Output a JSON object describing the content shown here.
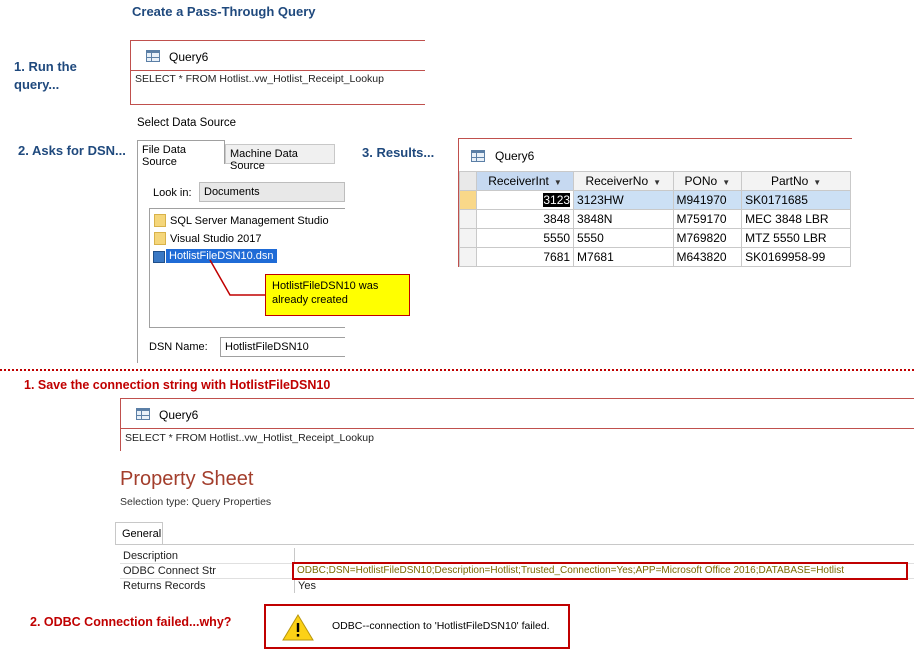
{
  "heading": "Create a Pass-Through Query",
  "steps": {
    "run_query": "1. Run the query...",
    "asks_dsn": "2. Asks for DSN...",
    "results": "3. Results...",
    "save_conn": "1. Save the connection string with HotlistFileDSN10",
    "odbc_failed": "2. ODBC Connection failed...why?"
  },
  "query_window_1": {
    "title": "Query6",
    "sql": "SELECT * FROM Hotlist..vw_Hotlist_Receipt_Lookup"
  },
  "dsn_dialog": {
    "title": "Select Data Source",
    "tabs": [
      "File Data Source",
      "Machine Data Source"
    ],
    "look_in_label": "Look in:",
    "look_in_value": "Documents",
    "items": [
      {
        "label": "SQL Server Management Studio",
        "icon": "folder-icon"
      },
      {
        "label": "Visual Studio 2017",
        "icon": "folder-icon"
      },
      {
        "label": "HotlistFileDSN10.dsn",
        "icon": "dsn-file-icon"
      }
    ],
    "dsn_name_label": "DSN Name:",
    "dsn_name_value": "HotlistFileDSN10",
    "callout": "HotlistFileDSN10 was already created"
  },
  "results_window": {
    "title": "Query6",
    "columns": [
      "ReceiverInt",
      "ReceiverNo",
      "PONo",
      "PartNo"
    ],
    "rows": [
      [
        "3123",
        "3123HW",
        "M941970",
        "SK0171685"
      ],
      [
        "3848",
        "3848N",
        "M759170",
        "MEC 3848 LBR"
      ],
      [
        "5550",
        "5550",
        "M769820",
        "MTZ 5550 LBR"
      ],
      [
        "7681",
        "M7681",
        "M643820",
        "SK0169958-99"
      ]
    ]
  },
  "query_window_2": {
    "title": "Query6",
    "sql": "SELECT * FROM Hotlist..vw_Hotlist_Receipt_Lookup"
  },
  "property_sheet": {
    "title": "Property Sheet",
    "selection_type": "Selection type:  Query Properties",
    "tab": "General",
    "rows": [
      {
        "label": "Description",
        "value": ""
      },
      {
        "label": "ODBC Connect Str",
        "value": "ODBC;DSN=HotlistFileDSN10;Description=Hotlist;Trusted_Connection=Yes;APP=Microsoft Office 2016;DATABASE=Hotlist"
      },
      {
        "label": "Returns Records",
        "value": "Yes"
      }
    ]
  },
  "error_dialog": {
    "message": "ODBC--connection to 'HotlistFileDSN10' failed.",
    "icon": "warning-icon"
  },
  "colors": {
    "accent_blue": "#1f497d",
    "accent_red": "#c00000",
    "callout_yellow": "#ffff00",
    "selection_blue": "#c6d9f1"
  }
}
